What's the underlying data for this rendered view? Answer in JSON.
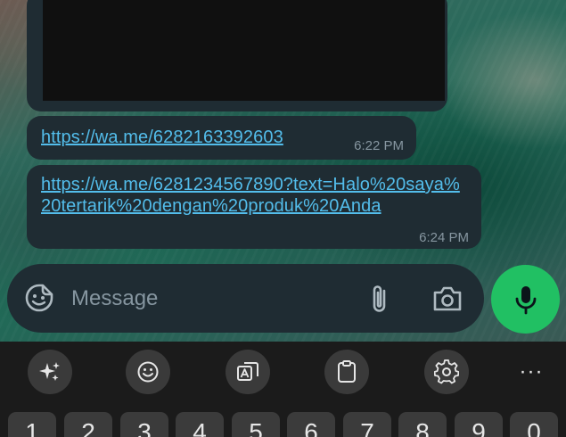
{
  "chat": {
    "messages": [
      {
        "link": "https://wa.me/6282163392603",
        "time": "6:22 PM"
      },
      {
        "link": "https://wa.me/6281234567890?text=Halo%20saya%20tertarik%20dengan%20produk%20Anda",
        "time": "6:24 PM"
      }
    ]
  },
  "composer": {
    "placeholder": "Message",
    "icons": [
      "sticker-icon",
      "paperclip-icon",
      "camera-icon",
      "microphone-icon"
    ]
  },
  "keyboard": {
    "toolbar_icons": [
      "ai-sparkle-icon",
      "emoji-icon",
      "translate-icon",
      "clipboard-icon",
      "settings-gear-icon",
      "more-icon"
    ],
    "more_label": "···",
    "number_keys": [
      "1",
      "2",
      "3",
      "4",
      "5",
      "6",
      "7",
      "8",
      "9",
      "0"
    ]
  },
  "colors": {
    "bubble": "#1f2c33",
    "link": "#53bdeb",
    "timestamp": "#8696a0",
    "mic_button": "#21c063"
  }
}
